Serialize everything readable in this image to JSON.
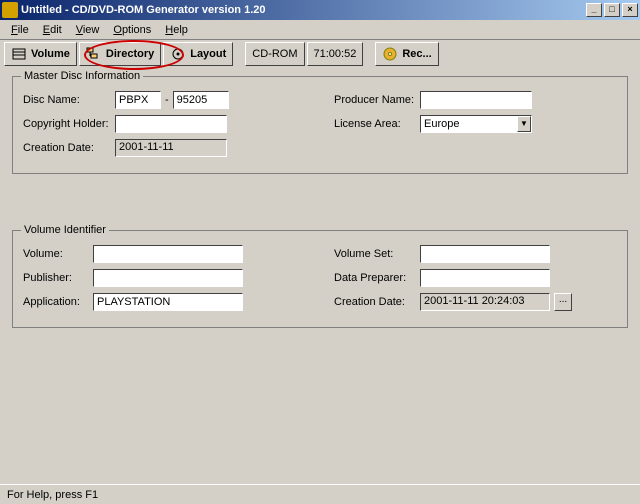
{
  "title": "Untitled - CD/DVD-ROM Generator version 1.20",
  "menu": {
    "file": "File",
    "edit": "Edit",
    "view": "View",
    "options": "Options",
    "help": "Help"
  },
  "toolbar": {
    "volume": "Volume",
    "directory": "Directory",
    "layout": "Layout",
    "cdrom": "CD-ROM",
    "time": "71:00:52",
    "rec": "Rec..."
  },
  "master": {
    "legend": "Master Disc Information",
    "disc_name_label": "Disc Name:",
    "disc_name_1": "PBPX",
    "sep": "-",
    "disc_name_2": "95205",
    "copyright_label": "Copyright Holder:",
    "copyright": "",
    "creation_label": "Creation Date:",
    "creation": "2001-11-11",
    "producer_label": "Producer Name:",
    "producer": "",
    "license_label": "License Area:",
    "license": "Europe"
  },
  "volume": {
    "legend": "Volume Identifier",
    "volume_label": "Volume:",
    "volume": "",
    "publisher_label": "Publisher:",
    "publisher": "",
    "application_label": "Application:",
    "application": "PLAYSTATION",
    "volset_label": "Volume Set:",
    "volset": "",
    "dataprep_label": "Data Preparer:",
    "dataprep": "",
    "creation_label": "Creation Date:",
    "creation": "2001-11-11 20:24:03",
    "ellipsis": "..."
  },
  "status": "For Help, press F1",
  "winbtns": {
    "min": "_",
    "max": "□",
    "close": "×"
  }
}
